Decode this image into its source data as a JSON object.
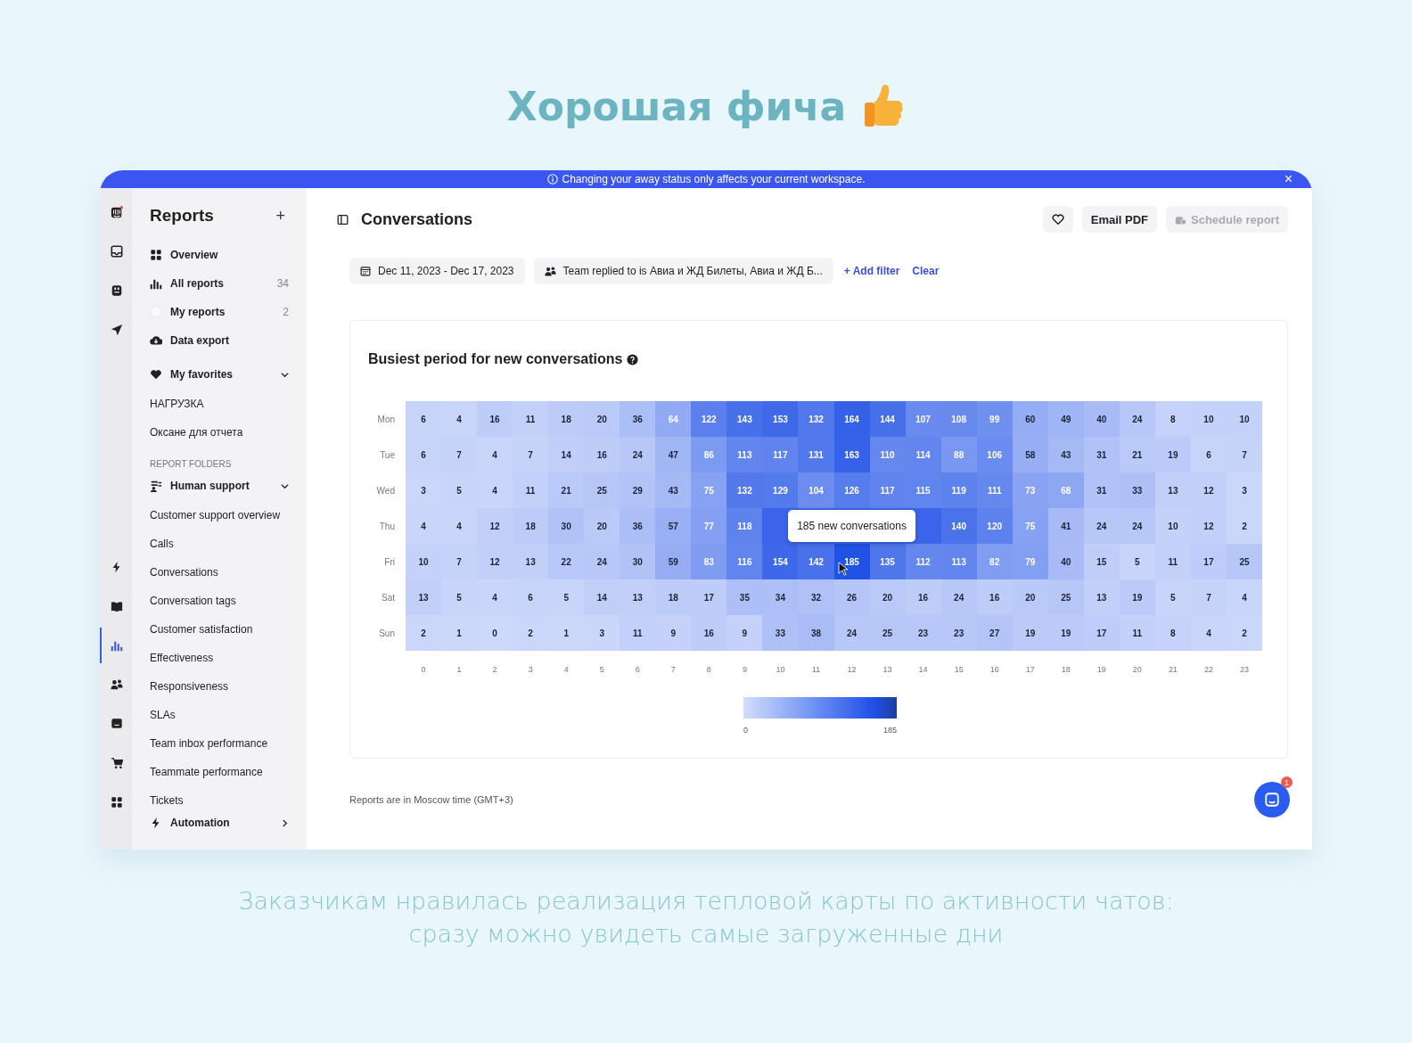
{
  "headline": "Хорошая фича",
  "banner": {
    "text": "Changing your away status only affects your current workspace.",
    "close": "×"
  },
  "rail_top": [
    {
      "selected": false
    },
    {
      "selected": false
    },
    {
      "selected": false
    },
    {
      "selected": false
    }
  ],
  "rail_bottom": [
    {
      "selected": false
    },
    {
      "selected": false
    },
    {
      "selected": true
    },
    {
      "selected": false
    },
    {
      "selected": false
    },
    {
      "selected": false
    },
    {
      "selected": false
    }
  ],
  "sidebar": {
    "title": "Reports",
    "add": "+",
    "nav": [
      {
        "label": "Overview"
      },
      {
        "label": "All reports",
        "count": "34"
      },
      {
        "label": "My reports",
        "count": "2"
      },
      {
        "label": "Data export"
      }
    ],
    "favorites": {
      "label": "My favorites",
      "expanded": true,
      "items": [
        "НАГРУЗКА",
        "Оксане для отчета"
      ]
    },
    "folders_heading": "REPORT FOLDERS",
    "folder": {
      "label": "Human support",
      "expanded": true,
      "items": [
        "Customer support overview",
        "Calls",
        "Conversations",
        "Conversation tags",
        "Customer satisfaction",
        "Effectiveness",
        "Responsiveness",
        "SLAs",
        "Team inbox performance",
        "Teammate performance",
        "Tickets"
      ]
    },
    "next_folder": {
      "label": "Automation",
      "expanded": false
    }
  },
  "header": {
    "title": "Conversations",
    "email_button": "Email PDF",
    "schedule_button": {
      "label": "Schedule report",
      "disabled": true
    }
  },
  "filters": {
    "date": "Dec 11, 2023 - Dec 17, 2023",
    "team": "Team replied to is Авиа и ЖД Билеты, Авиа и ЖД Б...",
    "add": "+ Add filter",
    "clear": "Clear"
  },
  "card": {
    "title": "Busiest period for new conversations",
    "days": [
      "Mon",
      "Tue",
      "Wed",
      "Thu",
      "Fri",
      "Sat",
      "Sun"
    ],
    "hours": [
      "0",
      "1",
      "2",
      "3",
      "4",
      "5",
      "6",
      "7",
      "8",
      "9",
      "10",
      "11",
      "12",
      "13",
      "14",
      "15",
      "16",
      "17",
      "18",
      "19",
      "20",
      "21",
      "22",
      "23"
    ],
    "rows": [
      [
        "6",
        "4",
        "16",
        "11",
        "18",
        "20",
        "36",
        "64",
        "122",
        "143",
        "153",
        "132",
        "164",
        "144",
        "107",
        "108",
        "99",
        "60",
        "49",
        "40",
        "24",
        "8",
        "10",
        "10"
      ],
      [
        "6",
        "7",
        "4",
        "7",
        "14",
        "16",
        "24",
        "47",
        "86",
        "113",
        "117",
        "131",
        "163",
        "110",
        "114",
        "88",
        "106",
        "58",
        "43",
        "31",
        "21",
        "19",
        "6",
        "7"
      ],
      [
        "3",
        "5",
        "4",
        "11",
        "21",
        "25",
        "29",
        "43",
        "75",
        "132",
        "129",
        "104",
        "126",
        "117",
        "115",
        "119",
        "111",
        "73",
        "68",
        "31",
        "33",
        "13",
        "12",
        "3"
      ],
      [
        "4",
        "4",
        "12",
        "18",
        "30",
        "20",
        "36",
        "57",
        "77",
        "118",
        null,
        null,
        null,
        null,
        null,
        "140",
        "120",
        "75",
        "41",
        "24",
        "24",
        "10",
        "12",
        "2"
      ],
      [
        "10",
        "7",
        "12",
        "13",
        "22",
        "24",
        "30",
        "59",
        "83",
        "116",
        "154",
        "142",
        "185",
        "135",
        "112",
        "113",
        "82",
        "79",
        "40",
        "15",
        "5",
        "11",
        "17",
        "25"
      ],
      [
        "13",
        "5",
        "4",
        "6",
        "5",
        "14",
        "13",
        "18",
        "17",
        "35",
        "34",
        "32",
        "26",
        "20",
        "16",
        "24",
        "16",
        "20",
        "25",
        "13",
        "19",
        "5",
        "7",
        "4"
      ],
      [
        "2",
        "1",
        "0",
        "2",
        "1",
        "3",
        "11",
        "9",
        "16",
        "9",
        "33",
        "38",
        "24",
        "25",
        "23",
        "23",
        "27",
        "19",
        "19",
        "17",
        "11",
        "8",
        "4",
        "2"
      ]
    ],
    "tooltip": {
      "text": "185 new conversations"
    },
    "legend": {
      "min": "0",
      "max": "185"
    }
  },
  "footnote": "Reports are in Moscow time (GMT+3)",
  "messenger": {
    "badge": "1"
  },
  "caption": [
    "Заказчикам нравилась реализация тепловой карты по активности чатов:",
    "сразу можно увидеть самые загруженные дни"
  ]
}
